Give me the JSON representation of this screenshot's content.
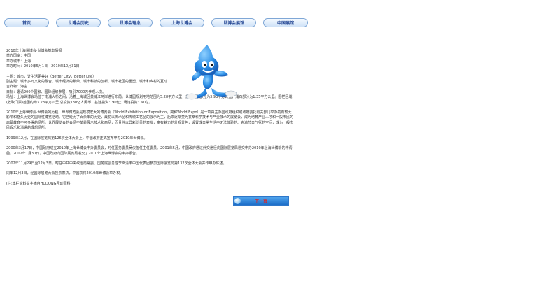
{
  "nav": {
    "items": [
      "首页",
      "世博会历史",
      "世博会理念",
      "上海世博会",
      "世博会展馆",
      "中国展馆"
    ]
  },
  "content": {
    "heading": "2010年上海世博会·世博会基本情报",
    "info": [
      "举办国家：中国",
      "举办城市：上海",
      "举办时间：2010年5月1日－2010年10月31日"
    ],
    "theme": [
      "主题：城市，让生活更美好（Better City，Better Life）",
      "副主题：城市多元文化的融合、城市经济的繁荣、城市科技的创新、城市社区的重塑、城市和乡村的互动",
      "吉祥物：海宝",
      "目标：邀请200个国家、国际组织参展，吸引7000万参观人次。",
      "场址：上海世博会场位于南浦大桥之间，沿着上海城区黄浦江两岸进行布局。世博园规划用地范围为5.28平方公里，其中浦东部分为3.93平方公里，浦西部分为1.35平方公里。围栏区域(收取门票)范围约为3.28平方公里,总投资180亿人民币：基建投资：90亿；场馆投资：90亿。"
    ],
    "intro": "2010年上海世博会·世博会的历程　世界博览会是规模宏大的博览会（World Exhibition or Exposition，简称World Expo）是一项由主办国政府组织或政府委托有关部门举办的有较大影响和悠久历史的国际性博览活动。它已经历了百余年的历史，最初以美术品和传统工艺品的展示为主，后来逐渐变为荟萃科学技术与产业技术的展览会，成为培育产业人才和一般市民的启蒙教育不可多得的场所。世界展览会的会场不单是展示技术和商品，而且伴以异彩纷呈的表演，富有魅力的壮观景色，设置成日常生活中无法体验的、充满节日气氛的空间，成为一般市民娱乐和消遣的理想场所。",
    "timeline": [
      "1999年12月，在国际展览局第126次全体大会上，中国政府正式宣布申办2010年世博会。",
      "2000年3月17日，中国政府成立2010年上海世博会申办委员会，时任国务委员吴仪担任主任委员。2001年5月，中国政府通过外交途径向国际展览局递交申办2010年上海世博会的申请函。2002年1月30日，中国政府向国际展览局递交了2010年上海世博会的申办报告。",
      "2002年11月29日至12月3日，时任中共中央政治局常委、国务院副总理李岚清率中国代表团参加国际展览局第132次全体大会并作申办陈述。",
      "同年12月3日，经国际展览大会投票表决，中国获得2010年世博会举办权。"
    ],
    "note": "(注:本栏资料文字摘自HUDONG互动百科)"
  },
  "next_button": {
    "label": "下一页"
  },
  "mascot": {
    "name": "海宝"
  },
  "colors": {
    "mascot_blue": "#2b8ee6",
    "nav_text": "#1b3f8f",
    "next_label": "#e02020"
  }
}
